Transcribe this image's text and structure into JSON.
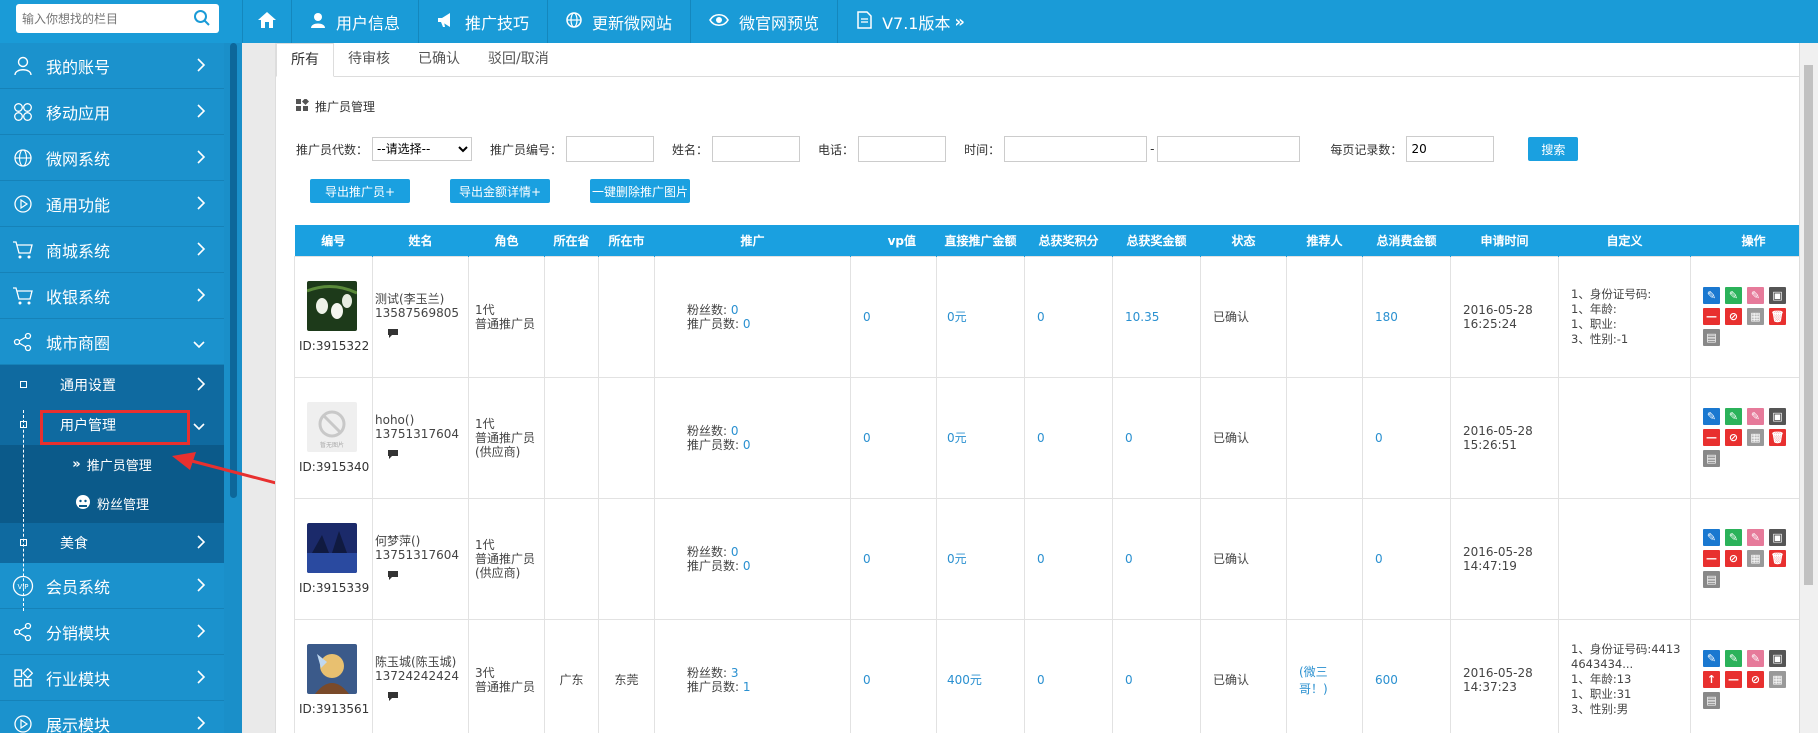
{
  "search": {
    "placeholder": "输入你想找的栏目"
  },
  "topnav": [
    {
      "label": "",
      "icon": "home-icon"
    },
    {
      "label": "用户信息",
      "icon": "user-icon"
    },
    {
      "label": "推广技巧",
      "icon": "megaphone-icon"
    },
    {
      "label": "更新微网站",
      "icon": "globe-icon"
    },
    {
      "label": "微官网预览",
      "icon": "eye-icon"
    },
    {
      "label": "V7.1版本",
      "icon": "document-icon"
    }
  ],
  "sidebar": {
    "items": [
      {
        "label": "我的账号",
        "icon": "user-icon"
      },
      {
        "label": "移动应用",
        "icon": "apps-icon"
      },
      {
        "label": "微网系统",
        "icon": "globe-icon"
      },
      {
        "label": "通用功能",
        "icon": "play-icon"
      },
      {
        "label": "商城系统",
        "icon": "cart-icon"
      },
      {
        "label": "收银系统",
        "icon": "cart-icon"
      },
      {
        "label": "城市商圈",
        "icon": "share-icon"
      }
    ],
    "sub": {
      "general_settings": "通用设置",
      "user_management": "用户管理",
      "promoter_management": "推广员管理",
      "fan_management": "粉丝管理",
      "food": "美食"
    },
    "items_after": [
      {
        "label": "会员系统",
        "icon": "vip-icon"
      },
      {
        "label": "分销模块",
        "icon": "share-icon"
      },
      {
        "label": "行业模块",
        "icon": "apps-icon"
      },
      {
        "label": "展示模块",
        "icon": "play-icon"
      }
    ]
  },
  "tabs": [
    "所有",
    "待审核",
    "已确认",
    "驳回/取消"
  ],
  "section_title": "推广员管理",
  "filters": {
    "level_label": "推广员代数：",
    "level_selected": "--请选择--",
    "number_label": "推广员编号：",
    "name_label": "姓名：",
    "phone_label": "电话：",
    "time_label": "时间：",
    "time_sep": "-",
    "per_page_label": "每页记录数：",
    "per_page_value": "20",
    "search_button": "搜索"
  },
  "actions": {
    "export_promoters": "导出推广员+",
    "export_amount": "导出金额详情+",
    "delete_images": "一键删除推广图片"
  },
  "table": {
    "headers": [
      "编号",
      "姓名",
      "角色",
      "所在省",
      "所在市",
      "推广",
      "vp值",
      "直接推广金额",
      "总获奖积分",
      "总获奖金额",
      "状态",
      "推荐人",
      "总消费金额",
      "申请时间",
      "自定义",
      "操作"
    ],
    "fans_label": "粉丝数:",
    "members_label": "推广员数:",
    "rows": [
      {
        "id": "ID:3915322",
        "name": "测试(李玉兰)",
        "phone": "13587569805",
        "role_line1": "1代",
        "role_line2": "普通推广员",
        "role_line3": "",
        "province": "",
        "city": "",
        "fans": "0",
        "members": "0",
        "vp": "0",
        "direct_amount": "0元",
        "points": "0",
        "award_amount": "10.35",
        "status": "已确认",
        "referrer": "",
        "consume": "180",
        "apply_date": "2016-05-28",
        "apply_time": "16:25:24",
        "custom": [
          "1、身份证号码:",
          "1、年龄:",
          "1、职业:",
          "3、性别:-1"
        ]
      },
      {
        "id": "ID:3915340",
        "name": "hoho()",
        "phone": "13751317604",
        "role_line1": "1代",
        "role_line2": "普通推广员",
        "role_line3": "(供应商)",
        "province": "",
        "city": "",
        "fans": "0",
        "members": "0",
        "vp": "0",
        "direct_amount": "0元",
        "points": "0",
        "award_amount": "0",
        "status": "已确认",
        "referrer": "",
        "consume": "0",
        "apply_date": "2016-05-28",
        "apply_time": "15:26:51",
        "custom": []
      },
      {
        "id": "ID:3915339",
        "name": "何梦萍()",
        "phone": "13751317604",
        "role_line1": "1代",
        "role_line2": "普通推广员",
        "role_line3": "(供应商)",
        "province": "",
        "city": "",
        "fans": "0",
        "members": "0",
        "vp": "0",
        "direct_amount": "0元",
        "points": "0",
        "award_amount": "0",
        "status": "已确认",
        "referrer": "",
        "consume": "0",
        "apply_date": "2016-05-28",
        "apply_time": "14:47:19",
        "custom": []
      },
      {
        "id": "ID:3913561",
        "name": "陈玉城(陈玉城)",
        "phone": "13724242424",
        "role_line1": "3代",
        "role_line2": "普通推广员",
        "role_line3": "",
        "province": "广东",
        "city": "东莞",
        "fans": "3",
        "members": "1",
        "vp": "0",
        "direct_amount": "400元",
        "points": "0",
        "award_amount": "0",
        "status": "已确认",
        "referrer": "(微三哥！)",
        "consume": "600",
        "apply_date": "2016-05-28",
        "apply_time": "14:37:23",
        "custom": [
          "1、身份证号码:44134643434...",
          "1、年龄:13",
          "1、职业:31",
          "3、性别:男"
        ]
      }
    ]
  },
  "colors": {
    "topbar": "#1a9bd7",
    "sidebar": "#1b92cd",
    "table_header": "#1aa0e0",
    "highlight": "#e8302f",
    "link_blue": "#2a90d0"
  }
}
